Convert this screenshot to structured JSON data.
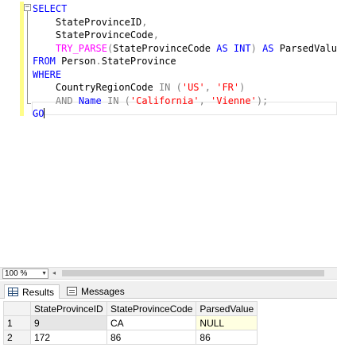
{
  "editor": {
    "collapse_glyph": "−",
    "lines": [
      [
        {
          "t": "SELECT",
          "c": "kw"
        }
      ],
      [
        {
          "t": "    StateProvinceID",
          "c": ""
        },
        {
          "t": ",",
          "c": "gr"
        }
      ],
      [
        {
          "t": "    StateProvinceCode",
          "c": ""
        },
        {
          "t": ",",
          "c": "gr"
        }
      ],
      [
        {
          "t": "    ",
          "c": ""
        },
        {
          "t": "TRY_PARSE",
          "c": "fn"
        },
        {
          "t": "(",
          "c": "gr"
        },
        {
          "t": "StateProvinceCode ",
          "c": ""
        },
        {
          "t": "AS",
          "c": "kw"
        },
        {
          "t": " ",
          "c": ""
        },
        {
          "t": "INT",
          "c": "kw"
        },
        {
          "t": ")",
          "c": "gr"
        },
        {
          "t": " ",
          "c": ""
        },
        {
          "t": "AS",
          "c": "kw"
        },
        {
          "t": " ParsedValue",
          "c": ""
        }
      ],
      [
        {
          "t": "FROM",
          "c": "kw"
        },
        {
          "t": " Person",
          "c": ""
        },
        {
          "t": ".",
          "c": "gr"
        },
        {
          "t": "StateProvince",
          "c": ""
        }
      ],
      [
        {
          "t": "WHERE",
          "c": "kw"
        }
      ],
      [
        {
          "t": "    CountryRegionCode ",
          "c": ""
        },
        {
          "t": "IN",
          "c": "gr"
        },
        {
          "t": " (",
          "c": "gr"
        },
        {
          "t": "'US'",
          "c": "st"
        },
        {
          "t": ", ",
          "c": "gr"
        },
        {
          "t": "'FR'",
          "c": "st"
        },
        {
          "t": ")",
          "c": "gr"
        }
      ],
      [
        {
          "t": "    ",
          "c": ""
        },
        {
          "t": "AND",
          "c": "gr"
        },
        {
          "t": " ",
          "c": ""
        },
        {
          "t": "Name",
          "c": "kw"
        },
        {
          "t": " ",
          "c": ""
        },
        {
          "t": "IN",
          "c": "gr"
        },
        {
          "t": " (",
          "c": "gr"
        },
        {
          "t": "'California'",
          "c": "st"
        },
        {
          "t": ", ",
          "c": "gr"
        },
        {
          "t": "'Vienne'",
          "c": "st"
        },
        {
          "t": ");",
          "c": "gr"
        }
      ],
      [
        {
          "t": "GO",
          "c": "kw"
        }
      ]
    ]
  },
  "zoom": {
    "value": "100 %",
    "arrow": "▼",
    "scroll_left_glyph": "◂"
  },
  "tabs": {
    "results": "Results",
    "messages": "Messages"
  },
  "results": {
    "columns": [
      "StateProvinceID",
      "StateProvinceCode",
      "ParsedValue"
    ],
    "rows": [
      {
        "num": "1",
        "cells": [
          "9",
          "CA",
          "NULL"
        ]
      },
      {
        "num": "2",
        "cells": [
          "172",
          "86",
          "86"
        ]
      }
    ]
  }
}
